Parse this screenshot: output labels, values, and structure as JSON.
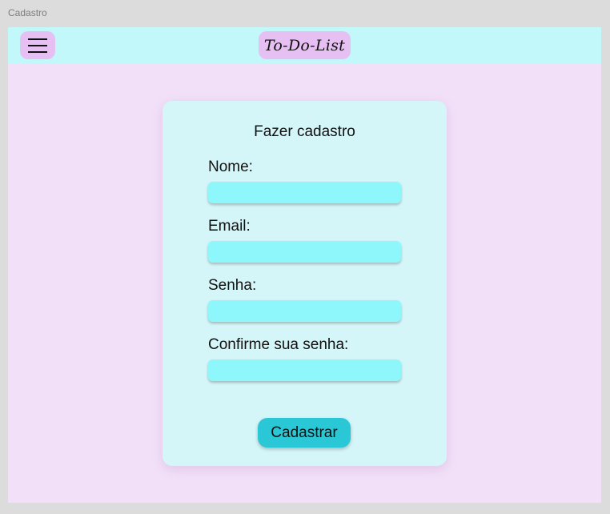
{
  "frame": {
    "label": "Cadastro"
  },
  "header": {
    "menu_icon": "hamburger-menu-icon",
    "logo_text": "To-Do-List"
  },
  "form": {
    "title": "Fazer cadastro",
    "fields": [
      {
        "label": "Nome:",
        "value": "",
        "placeholder": ""
      },
      {
        "label": "Email:",
        "value": "",
        "placeholder": ""
      },
      {
        "label": "Senha:",
        "value": "",
        "placeholder": ""
      },
      {
        "label": "Confirme sua senha:",
        "value": "",
        "placeholder": ""
      }
    ],
    "submit_label": "Cadastrar"
  },
  "colors": {
    "page_background": "#f2e0f8",
    "header_background": "#c2f8fa",
    "accent_pink": "#e7c0f3",
    "card_background": "#d5f6f9",
    "input_background": "#8ef7fb",
    "button_background": "#2ac8d6"
  }
}
